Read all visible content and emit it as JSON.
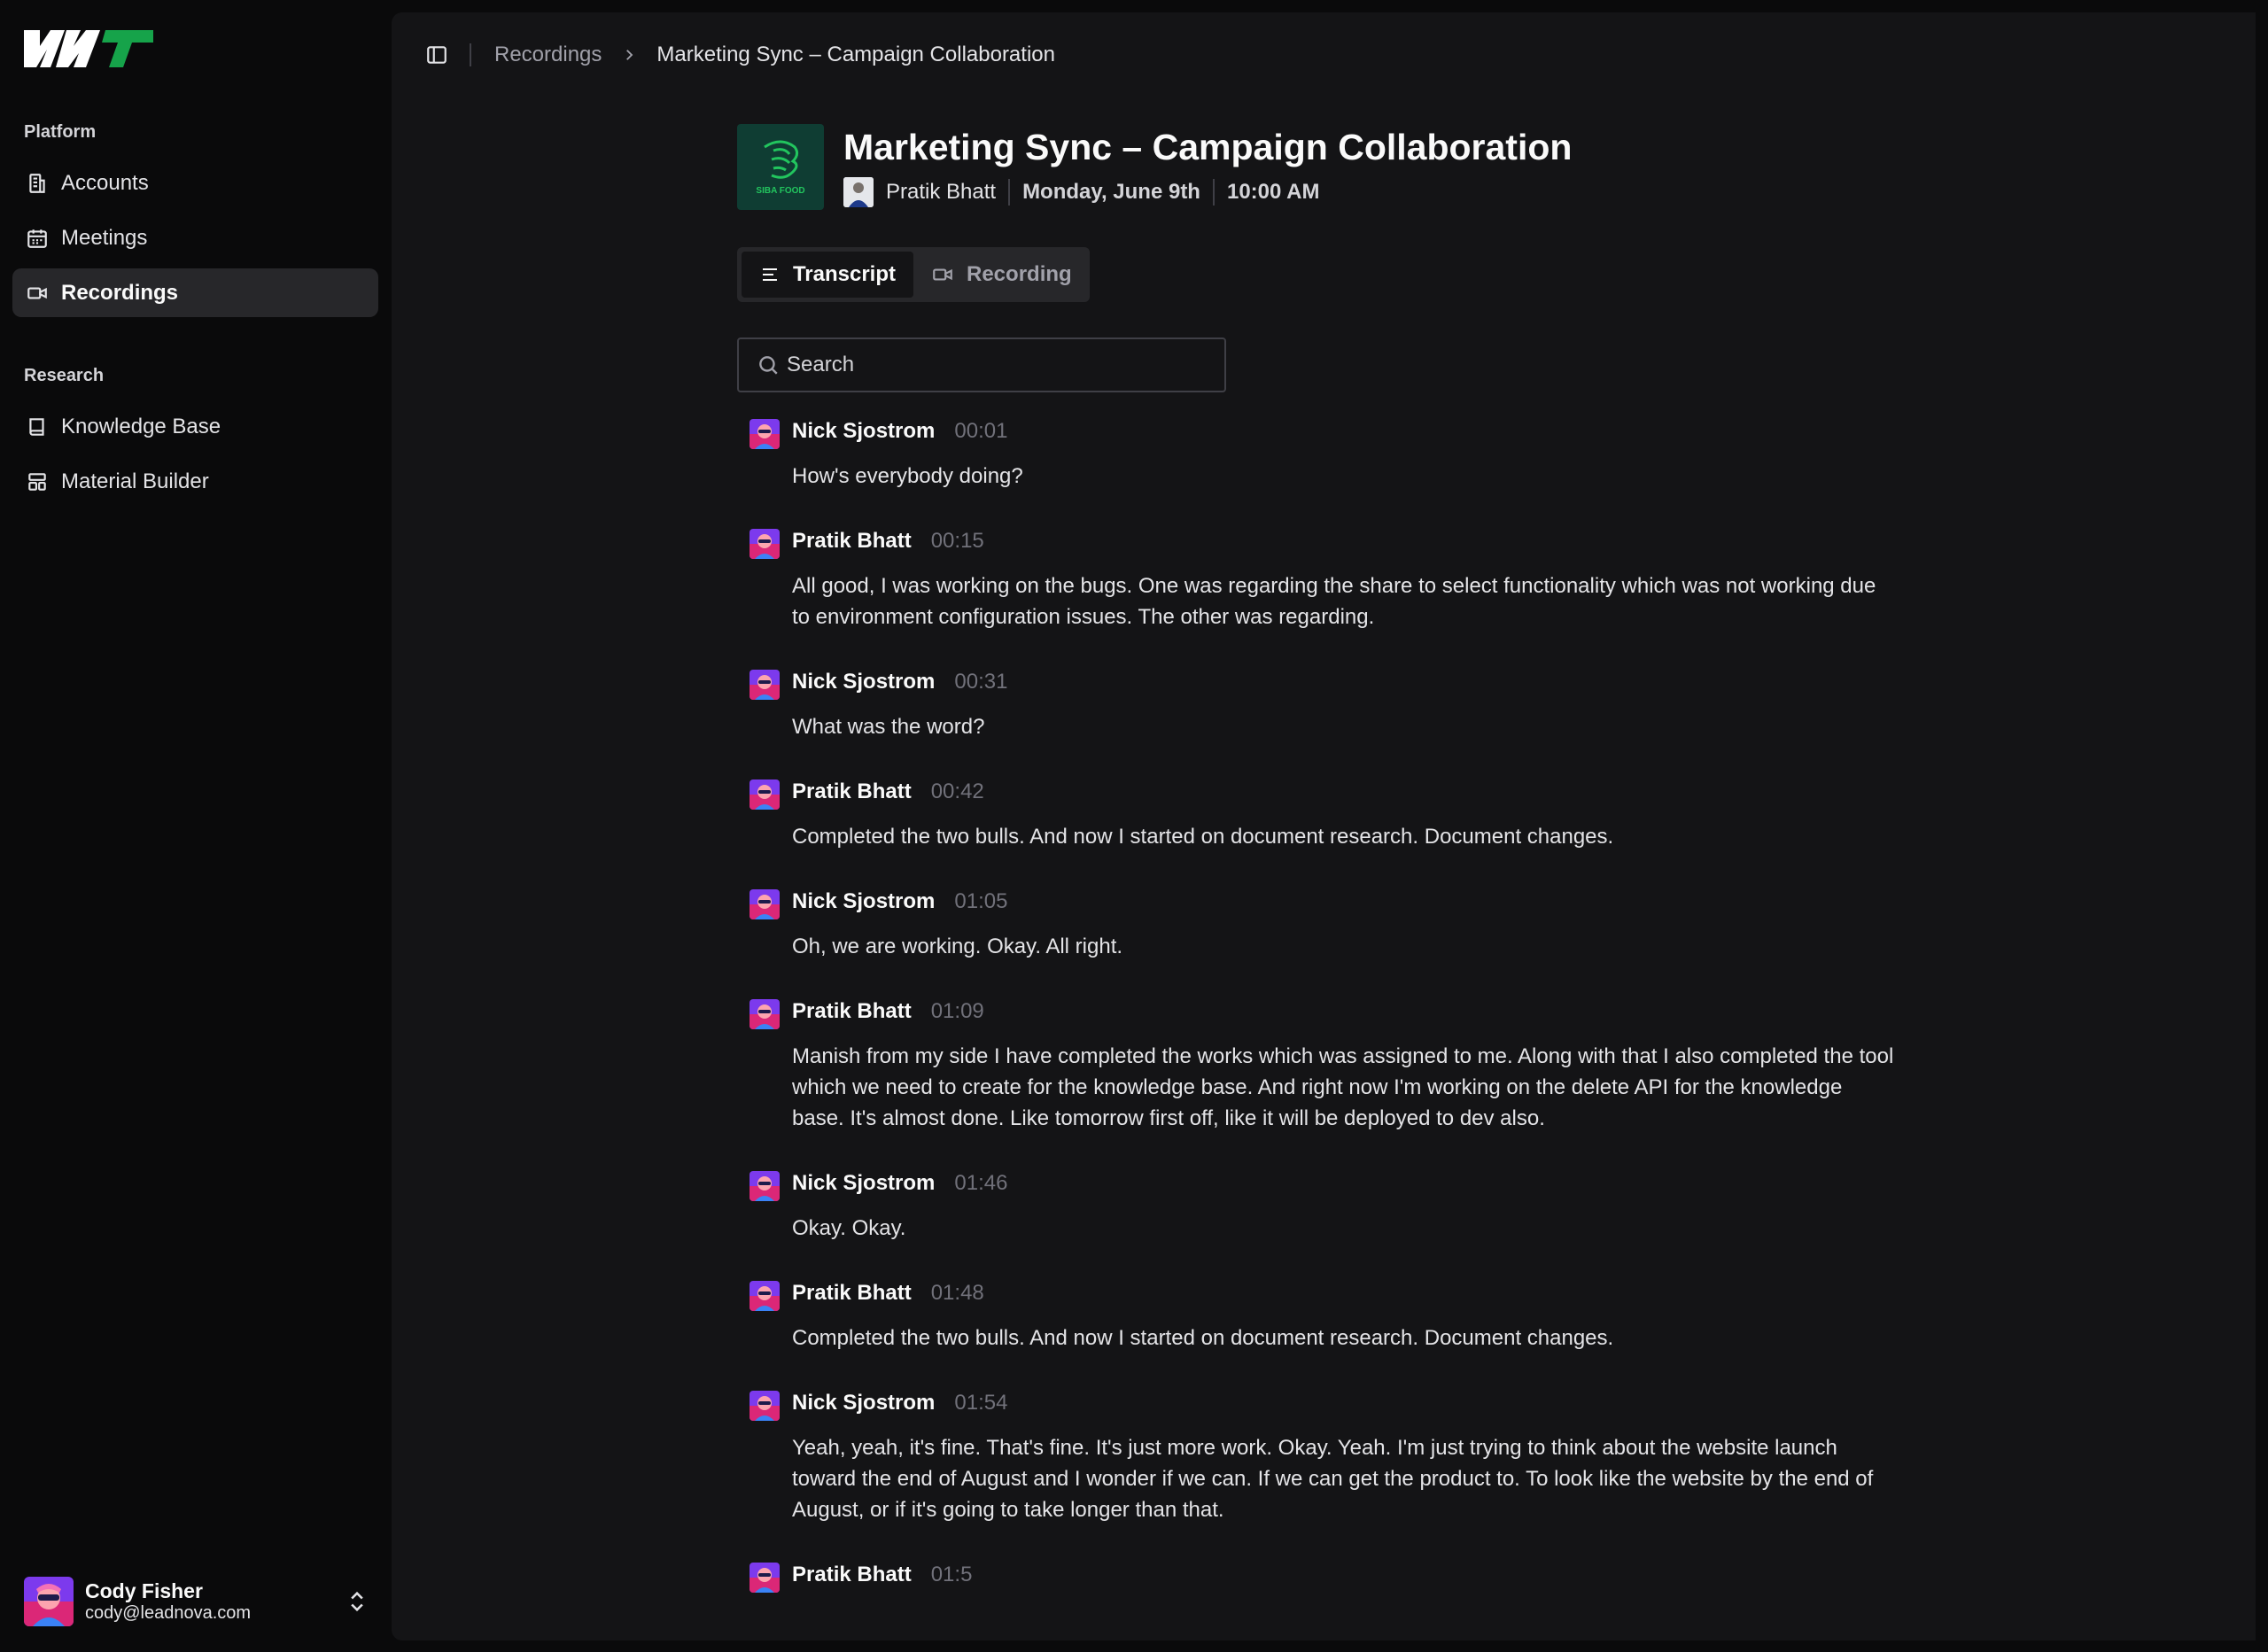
{
  "sidebar": {
    "sections": [
      {
        "label": "Platform",
        "items": [
          {
            "label": "Accounts",
            "icon": "building-icon"
          },
          {
            "label": "Meetings",
            "icon": "calendar-icon"
          },
          {
            "label": "Recordings",
            "icon": "video-icon",
            "active": true
          }
        ]
      },
      {
        "label": "Research",
        "items": [
          {
            "label": "Knowledge Base",
            "icon": "book-icon"
          },
          {
            "label": "Material Builder",
            "icon": "layout-icon"
          }
        ]
      }
    ],
    "user": {
      "name": "Cody Fisher",
      "email": "cody@leadnova.com"
    }
  },
  "breadcrumb": {
    "parent": "Recordings",
    "current": "Marketing Sync – Campaign Collaboration"
  },
  "meeting": {
    "title": "Marketing Sync – Campaign Collaboration",
    "brand_text": "SIBA FOOD",
    "host": "Pratik Bhatt",
    "date": "Monday, June 9th",
    "time": "10:00 AM"
  },
  "tabs": {
    "transcript": "Transcript",
    "recording": "Recording"
  },
  "search": {
    "placeholder": "Search"
  },
  "transcript": [
    {
      "speaker": "Nick Sjostrom",
      "time": "00:01",
      "text": "How's everybody doing?"
    },
    {
      "speaker": "Pratik Bhatt",
      "time": "00:15",
      "text": "All good, I was working on the bugs. One was regarding the share to select functionality which was not working due to environment configuration issues. The other was regarding."
    },
    {
      "speaker": "Nick Sjostrom",
      "time": "00:31",
      "text": "What was the word?"
    },
    {
      "speaker": "Pratik Bhatt",
      "time": "00:42",
      "text": "Completed the two bulls. And now I started on document research. Document changes."
    },
    {
      "speaker": "Nick Sjostrom",
      "time": "01:05",
      "text": "Oh, we are working. Okay. All right."
    },
    {
      "speaker": "Pratik Bhatt",
      "time": "01:09",
      "text": "Manish from my side I have completed the works which was assigned to me. Along with that I also completed the tool which we need to create for the knowledge base. And right now I'm working on the delete API for the knowledge base. It's almost done. Like tomorrow first off, like it will be deployed to dev also."
    },
    {
      "speaker": "Nick Sjostrom",
      "time": "01:46",
      "text": "Okay. Okay."
    },
    {
      "speaker": "Pratik Bhatt",
      "time": "01:48",
      "text": "Completed the two bulls. And now I started on document research. Document changes."
    },
    {
      "speaker": "Nick Sjostrom",
      "time": "01:54",
      "text": "Yeah, yeah, it's fine. That's fine. It's just more work. Okay. Yeah. I'm just trying to think about the website launch toward the end of August and I wonder if we can. If we can get the product to. To look like the website by the end of August, or if it's going to take longer than that."
    },
    {
      "speaker": "Pratik Bhatt",
      "time": "01:5",
      "text": ""
    }
  ],
  "colors": {
    "background": "#0a0a0b",
    "panel": "#141416",
    "active_nav": "#27272a",
    "brand_green": "#22c55e"
  }
}
